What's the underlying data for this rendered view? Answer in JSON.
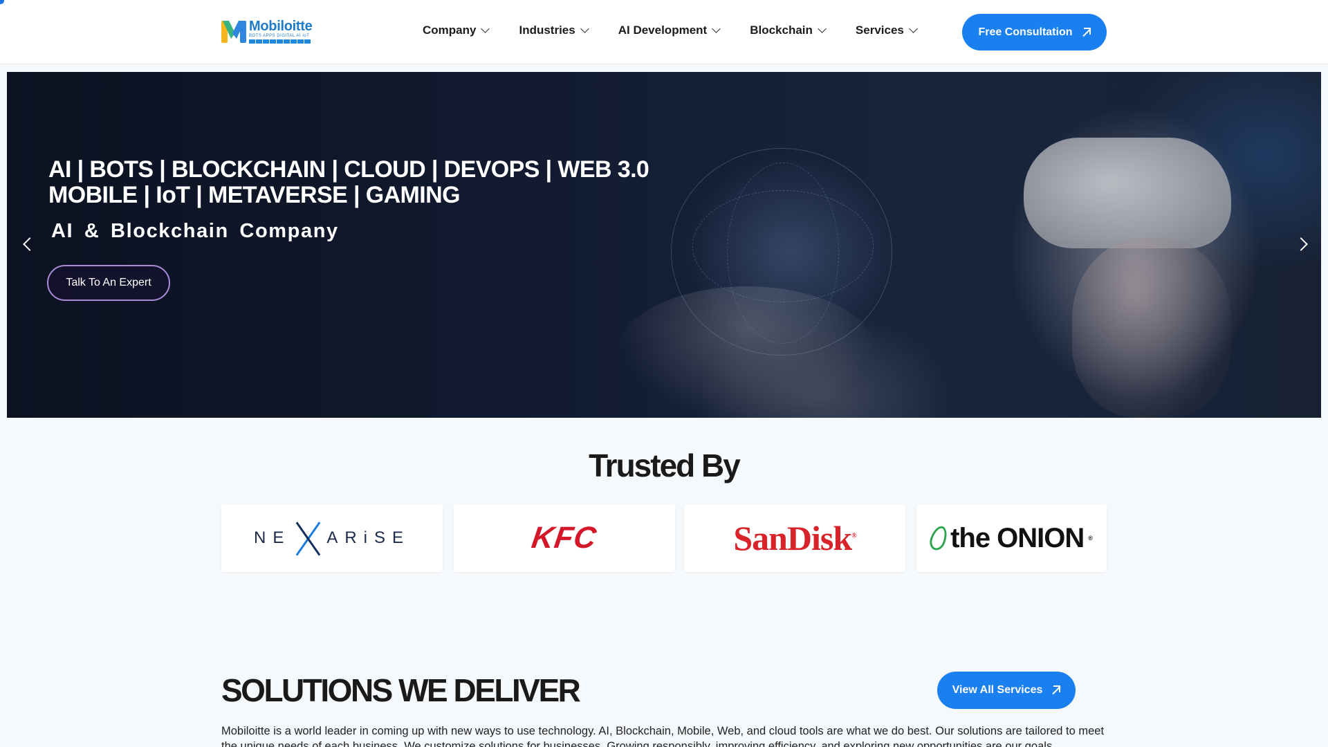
{
  "header": {
    "logo": {
      "name": "Mobiloitte",
      "tagline": "BOTS APPS DIGITAL AI IoT"
    },
    "nav": [
      {
        "label": "Company"
      },
      {
        "label": "Industries"
      },
      {
        "label": "AI Development"
      },
      {
        "label": "Blockchain"
      },
      {
        "label": "Services"
      }
    ],
    "cta_label": "Free Consultation"
  },
  "hero": {
    "title_line1": "AI | BOTS | BLOCKCHAIN | CLOUD | DEVOPS | WEB 3.0",
    "title_line2": "MOBILE | IoT | METAVERSE | GAMING",
    "subtitle": "AI & Blockchain Company",
    "button_label": "Talk To An Expert"
  },
  "trusted": {
    "title": "Trusted By",
    "logos": [
      {
        "name": "NEXARISE",
        "left": "NE",
        "right": "ARiSE"
      },
      {
        "name": "KFC"
      },
      {
        "name": "SanDisk"
      },
      {
        "name": "the ONION"
      }
    ]
  },
  "solutions": {
    "title": "SOLUTIONS WE DELIVER",
    "button_label": "View All Services",
    "description": "Mobiloitte is a world leader in coming up with new ways to use technology. AI, Blockchain, Mobile, Web, and cloud tools are what we do best. Our solutions are tailored to meet the unique needs of each business. We customize solutions for businesses. Growing responsibly, improving efficiency, and exploring new opportunities are our goals."
  },
  "colors": {
    "accent": "#1a80f0",
    "brand_blue": "#1f7ac8",
    "kfc_red": "#d4182a",
    "sandisk_red": "#d8232a",
    "hero_bg": "#16213a"
  },
  "icons": [
    "chevron-down-icon",
    "arrow-up-right-icon",
    "chevron-left-icon",
    "chevron-right-icon",
    "onion-leaf-icon"
  ]
}
